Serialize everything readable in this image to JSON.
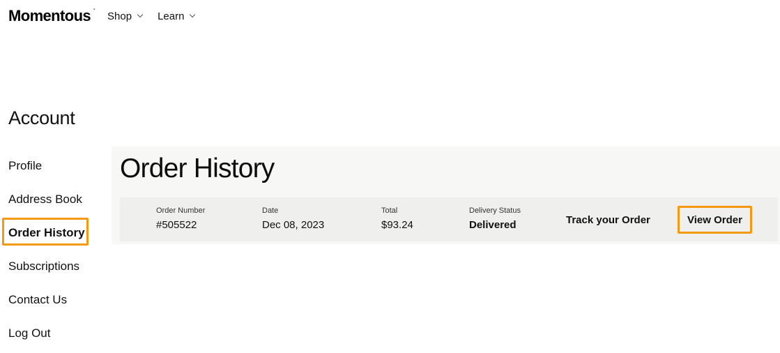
{
  "header": {
    "logo": "Momentous",
    "logo_mark": "°",
    "nav": [
      {
        "label": "Shop",
        "icon": "chevron-down-icon"
      },
      {
        "label": "Learn",
        "icon": "chevron-down-icon"
      }
    ]
  },
  "sidebar": {
    "title": "Account",
    "items": [
      {
        "label": "Profile"
      },
      {
        "label": "Address Book"
      },
      {
        "label": "Order History",
        "active": true
      },
      {
        "label": "Subscriptions"
      },
      {
        "label": "Contact Us"
      },
      {
        "label": "Log Out"
      }
    ]
  },
  "main": {
    "title": "Order History",
    "order": {
      "number_label": "Order Number",
      "number_value": "#505522",
      "date_label": "Date",
      "date_value": "Dec 08, 2023",
      "total_label": "Total",
      "total_value": "$93.24",
      "status_label": "Delivery Status",
      "status_value": "Delivered",
      "track_label": "Track your Order",
      "view_label": "View Order"
    }
  },
  "colors": {
    "highlight": "#f59a10",
    "panel_bg": "#f7f7f5",
    "row_bg": "#efefed",
    "text": "#111111"
  }
}
